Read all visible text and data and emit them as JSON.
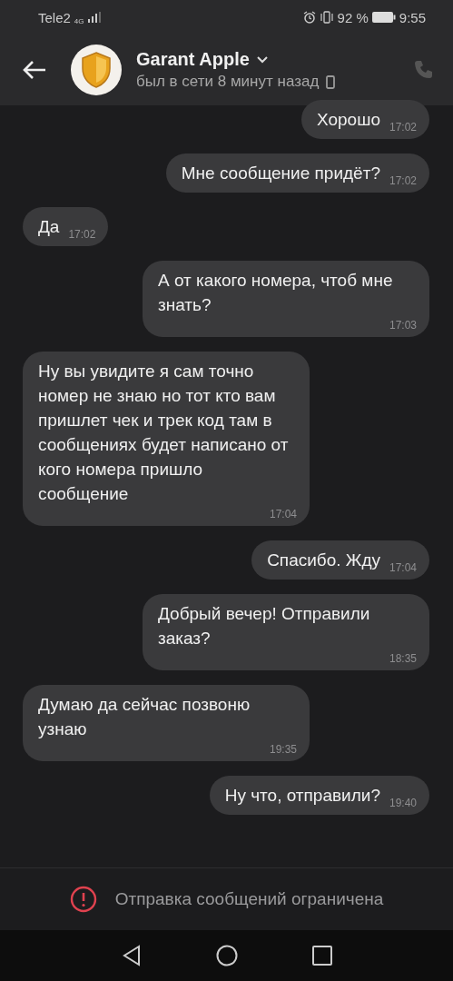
{
  "status_bar": {
    "carrier": "Tele2",
    "network": "4G",
    "battery": "92 %",
    "time": "9:55"
  },
  "header": {
    "name": "Garant Apple",
    "status": "был в сети 8 минут назад"
  },
  "messages": [
    {
      "kind": "outgoing",
      "text": "Хорошо",
      "time": "17:02"
    },
    {
      "kind": "outgoing",
      "text": "Мне сообщение придёт?",
      "time": "17:02"
    },
    {
      "kind": "incoming",
      "text": "Да",
      "time": "17:02"
    },
    {
      "kind": "outgoing",
      "text": "А от какого номера, чтоб мне знать?",
      "time": "17:03"
    },
    {
      "kind": "incoming",
      "text": "Ну вы увидите я сам точно номер не знаю но тот кто вам пришлет чек и трек код там в сообщениях будет написано от кого номера пришло сообщение",
      "time": "17:04"
    },
    {
      "kind": "outgoing",
      "text": "Спасибо. Жду",
      "time": "17:04"
    },
    {
      "kind": "outgoing",
      "text": "Добрый вечер! Отправили заказ?",
      "time": "18:35"
    },
    {
      "kind": "incoming",
      "text": "Думаю да сейчас позвоню узнаю",
      "time": "19:35"
    },
    {
      "kind": "outgoing",
      "text": "Ну что, отправили?",
      "time": "19:40"
    }
  ],
  "notice": "Отправка сообщений ограничена"
}
